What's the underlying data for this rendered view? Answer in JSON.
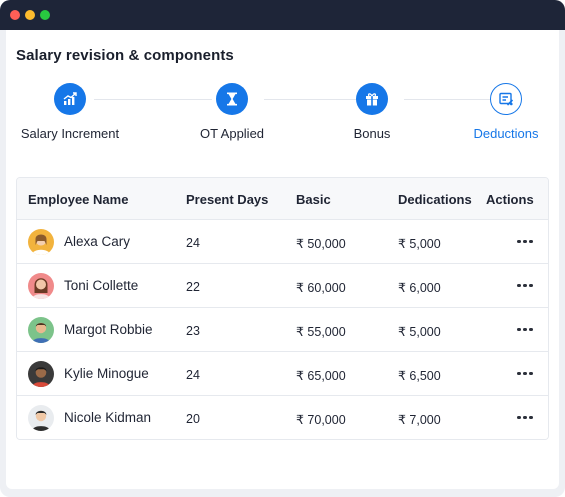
{
  "page": {
    "title": "Salary revision & components"
  },
  "steps": [
    {
      "label": "Salary Increment",
      "icon": "chart-growth-icon",
      "state": "complete"
    },
    {
      "label": "OT Applied",
      "icon": "hourglass-icon",
      "state": "complete"
    },
    {
      "label": "Bonus",
      "icon": "gift-icon",
      "state": "complete"
    },
    {
      "label": "Deductions",
      "icon": "deduction-icon",
      "state": "active"
    }
  ],
  "table": {
    "headers": {
      "name": "Employee Name",
      "present_days": "Present Days",
      "basic": "Basic",
      "deductions": "Dedications",
      "actions": "Actions"
    },
    "rows": [
      {
        "name": "Alexa Cary",
        "present_days": "24",
        "basic": "₹ 50,000",
        "deductions": "₹ 5,000",
        "avatar_bg": "#f2b33d"
      },
      {
        "name": "Toni Collette",
        "present_days": "22",
        "basic": "₹ 60,000",
        "deductions": "₹ 6,000",
        "avatar_bg": "#f08a8a"
      },
      {
        "name": "Margot Robbie",
        "present_days": "23",
        "basic": "₹ 55,000",
        "deductions": "₹ 5,000",
        "avatar_bg": "#7cc38a"
      },
      {
        "name": "Kylie Minogue",
        "present_days": "24",
        "basic": "₹ 65,000",
        "deductions": "₹ 6,500",
        "avatar_bg": "#3a3a3a"
      },
      {
        "name": "Nicole Kidman",
        "present_days": "20",
        "basic": "₹ 70,000",
        "deductions": "₹ 7,000",
        "avatar_bg": "#e9ecef"
      }
    ]
  },
  "colors": {
    "accent": "#1677e8",
    "titlebar": "#1e2538"
  }
}
